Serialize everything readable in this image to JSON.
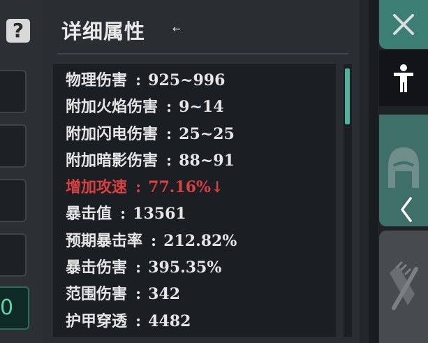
{
  "help": {
    "label": "?"
  },
  "partial_value": "0",
  "panel": {
    "title": "详细属性",
    "title_arrow": "←",
    "stats": [
      {
        "label": "物理伤害",
        "value": "925~996",
        "negative": false
      },
      {
        "label": "附加火焰伤害",
        "value": "9~14",
        "negative": false
      },
      {
        "label": "附加闪电伤害",
        "value": "25~25",
        "negative": false
      },
      {
        "label": "附加暗影伤害",
        "value": "88~91",
        "negative": false
      },
      {
        "label": "增加攻速",
        "value": "77.16%↓",
        "negative": true
      },
      {
        "label": "暴击值",
        "value": "13561",
        "negative": false
      },
      {
        "label": "预期暴击率",
        "value": "212.82%",
        "negative": false
      },
      {
        "label": "暴击伤害",
        "value": "395.35%",
        "negative": false
      },
      {
        "label": "范围伤害",
        "value": "342",
        "negative": false
      },
      {
        "label": "护甲穿透",
        "value": "4482",
        "negative": false
      }
    ],
    "separator": ":"
  },
  "colors": {
    "accent": "#3d7e74",
    "negative": "#d94040",
    "scroll_thumb": "#4fb39b",
    "value_green": "#5fd3a5"
  },
  "icons": [
    "question-icon",
    "close-icon",
    "person-icon",
    "helmet-icon",
    "gloves-icon",
    "chevron-left-icon"
  ]
}
